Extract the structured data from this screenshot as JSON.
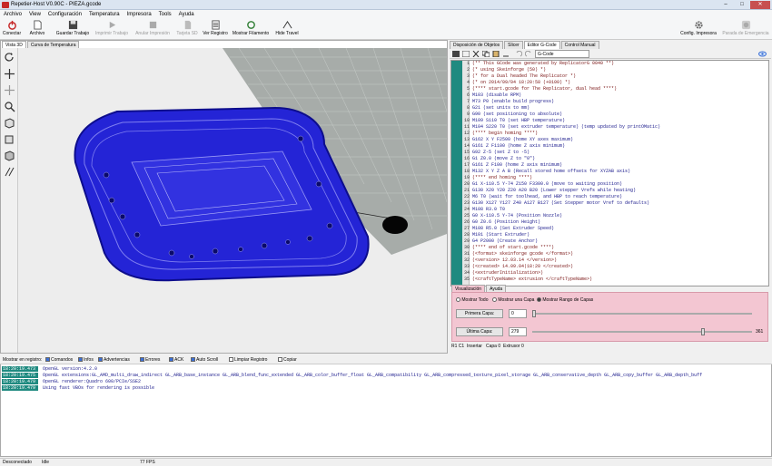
{
  "window": {
    "title": "Repetier-Host V0.90C - PIEZA.gcode",
    "minimize": "–",
    "maximize": "□",
    "close": "✕"
  },
  "menu": [
    "Archivo",
    "View",
    "Configuración",
    "Temperatura",
    "Impresora",
    "Tools",
    "Ayuda"
  ],
  "toolbar": {
    "connect": "Conectar",
    "file": "Archivo",
    "save_job": "Guardar Trabajo",
    "print_job": "Imprimir Trabajo",
    "cancel_print": "Anular Impresión",
    "sd_card": "Tarjeta SD",
    "view_log": "Ver Registro",
    "show_filament": "Mostrar Filamento",
    "hide_travel": "Hide Travel",
    "printer_config": "Config. Impresora",
    "emergency_stop": "Parada de Emergencia"
  },
  "left_tabs": [
    "Vista 3D",
    "Curva de Temperatura"
  ],
  "right_tabs": [
    "Disposición de Objetos",
    "Slicer",
    "Editor G-Code",
    "Control Manual"
  ],
  "editor": {
    "file_select": "G-Code"
  },
  "gcode_lines": [
    {
      "n": "1",
      "t": "(** This GCode was generated by ReplicatorG 0040 **)",
      "k": "cmt"
    },
    {
      "n": "2",
      "t": "(*  using Skeinforge (50)  *)",
      "k": "cmt"
    },
    {
      "n": "3",
      "t": "(*  for a Dual headed The Replicator  *)",
      "k": "cmt"
    },
    {
      "n": "4",
      "t": "(*  on 2014/09/04 18:20:58 (+0100) *)",
      "k": "cmt"
    },
    {
      "n": "5",
      "t": "(**** start.gcode for The Replicator, dual head ****)",
      "k": "cmt"
    },
    {
      "n": "6",
      "t": "M103 (disable RPM)",
      "k": "cmd"
    },
    {
      "n": "7",
      "t": "M73 P0 (enable build progress)",
      "k": "cmd"
    },
    {
      "n": "8",
      "t": "G21 (set units to mm)",
      "k": "cmd"
    },
    {
      "n": "9",
      "t": "G90 (set positioning to absolute)",
      "k": "cmd"
    },
    {
      "n": "10",
      "t": "M109 S110 T0 (set HBP temperature)",
      "k": "cmd"
    },
    {
      "n": "11",
      "t": "M104 S220 T0 (set extruder temperature) (temp updated by printOMatic)",
      "k": "cmd"
    },
    {
      "n": "12",
      "t": "(**** begin homing ****)",
      "k": "cmt"
    },
    {
      "n": "13",
      "t": "G162 X Y F2500 (home XY axes maximum)",
      "k": "cmd"
    },
    {
      "n": "14",
      "t": "G161 Z F1100 (home Z axis minimum)",
      "k": "cmd"
    },
    {
      "n": "15",
      "t": "G92 Z-5 (set Z to -5)",
      "k": "cmd"
    },
    {
      "n": "16",
      "t": "G1 Z0.0 (move Z to \"0\")",
      "k": "cmd"
    },
    {
      "n": "17",
      "t": "G161 Z F100 (home Z axis minimum)",
      "k": "cmd"
    },
    {
      "n": "18",
      "t": "M132 X Y Z A B (Recall stored home offsets for XYZAB axis)",
      "k": "cmd"
    },
    {
      "n": "19",
      "t": "(**** end homing ****)",
      "k": "cmt"
    },
    {
      "n": "20",
      "t": "G1 X-110.5 Y-74 Z150 F3300.0 (move to waiting position)",
      "k": "cmd"
    },
    {
      "n": "21",
      "t": "G130 X20 Y20 Z20 A20 B20 (Lower stepper Vrefs while heating)",
      "k": "cmd"
    },
    {
      "n": "22",
      "t": "M6 T0 (wait for toolhead, and HBP to reach temperature)",
      "k": "cmd"
    },
    {
      "n": "23",
      "t": "G130 X127 Y127 Z40 A127 B127 (Set Stepper motor Vref to defaults)",
      "k": "cmd"
    },
    {
      "n": "24",
      "t": "M108 R3.0 T0",
      "k": "cmd"
    },
    {
      "n": "25",
      "t": "G0 X-110.5 Y-74 (Position Nozzle)",
      "k": "cmd"
    },
    {
      "n": "26",
      "t": "G0 Z0.6      (Position Height)",
      "k": "cmd"
    },
    {
      "n": "27",
      "t": "M108 R5.0    (Set Extruder Speed)",
      "k": "cmd"
    },
    {
      "n": "28",
      "t": "M101         (Start Extruder)",
      "k": "cmd"
    },
    {
      "n": "29",
      "t": "G4 P2000     (Create Anchor)",
      "k": "cmd"
    },
    {
      "n": "30",
      "t": "(**** end of start.gcode ****)",
      "k": "cmt"
    },
    {
      "n": "31",
      "t": "(<format> skeinforge gcode </format>)",
      "k": "cmt"
    },
    {
      "n": "32",
      "t": "(<version> 12.03.14 </version>)",
      "k": "cmt"
    },
    {
      "n": "33",
      "t": "(<created> 14.09.04|18:20 </created>)",
      "k": "cmt"
    },
    {
      "n": "34",
      "t": "(<extruderInitialization>)",
      "k": "cmt"
    },
    {
      "n": "35",
      "t": "(<craftTypeName> extrusion </craftTypeName>)",
      "k": "cmt"
    }
  ],
  "viz": {
    "tabs": [
      "Visualización",
      "Ayuda"
    ],
    "show_all": "Mostrar Todo",
    "show_one": "Mostrar una Capa",
    "show_range": "Mostrar Rango de Capas",
    "first_layer_label": "Primera Capa:",
    "first_layer_value": "0",
    "last_layer_label": "Última Capa:",
    "last_layer_value": "279",
    "max_layer": "361",
    "last_fraction": 0.77
  },
  "editor_status": {
    "pos": "R1  C1",
    "mode": "Insertar",
    "layer": "Capa 0",
    "extruder": "Extrusor 0"
  },
  "log_bar": {
    "show_in_log": "Mostrar en registro:",
    "commands": "Comandos",
    "info": "Infos",
    "warnings": "Advertencias",
    "errors": "Errores",
    "ack": "ACK",
    "autoscroll": "Auto Scroll",
    "clear": "Limpiar Registro",
    "copy": "Copiar"
  },
  "log": [
    {
      "ts": "18:20:19.473",
      "msg": "OpenGL version:4.2.0"
    },
    {
      "ts": "18:20:19.475",
      "msg": "OpenGL extensions:GL_AMD_multi_draw_indirect GL_ARB_base_instance GL_ARB_blend_func_extended GL_ARB_color_buffer_float GL_ARB_compatibility GL_ARB_compressed_texture_pixel_storage GL_ARB_conservative_depth GL_ARB_copy_buffer GL_ARB_depth_buff"
    },
    {
      "ts": "18:20:19.479",
      "msg": "OpenGL renderer:Quadro 600/PCIe/SSE2"
    },
    {
      "ts": "18:20:19.479",
      "msg": "Using fast VBOs for rendering is possible"
    }
  ],
  "status": {
    "connection": "Desconectado",
    "state": "Idle",
    "fps": "77 FPS"
  },
  "colors": {
    "model": "#2424d6",
    "teal": "#1f8a80",
    "viz_panel": "#f3c6d2"
  }
}
